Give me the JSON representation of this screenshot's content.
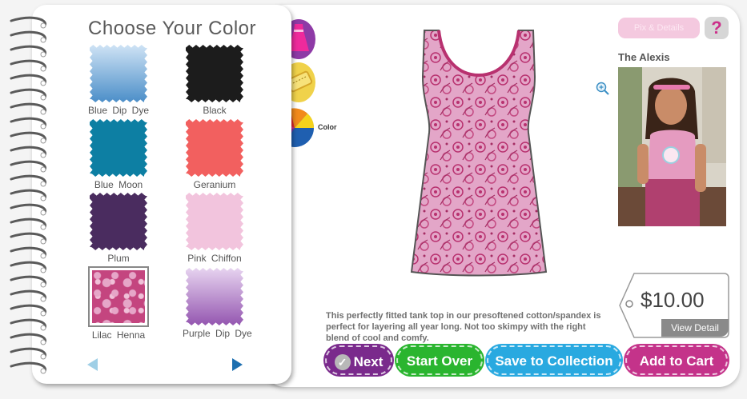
{
  "left_panel": {
    "title": "Choose Your Color",
    "swatches": [
      {
        "label": "Blue  Dip  Dye",
        "color_top": "#cfe3f5",
        "color_bottom": "#4b8ec8"
      },
      {
        "label": "Black",
        "color": "#1c1c1c"
      },
      {
        "label": "Blue  Moon",
        "color": "#0d7fa3"
      },
      {
        "label": "Geranium",
        "color": "#f2605f"
      },
      {
        "label": "Plum",
        "color": "#4a2c5f"
      },
      {
        "label": "Pink  Chiffon",
        "color": "#f2c4dd"
      },
      {
        "label": "Lilac  Henna",
        "color": "#c4457f",
        "selected": true
      },
      {
        "label": "Purple  Dip  Dye",
        "color_top": "#e7d4f0",
        "color_bottom": "#9456b0"
      }
    ],
    "prev_icon": "left-arrow",
    "next_icon": "right-arrow"
  },
  "side_tabs": {
    "style_icon": "dress-icon",
    "size_icon": "tape-measure-icon",
    "color_label": "Color"
  },
  "header": {
    "pix_details": "Pix & Details",
    "help": "?"
  },
  "model": {
    "title": "The Alexis"
  },
  "price": {
    "amount": "$10.00",
    "view_detail": "View  Detail"
  },
  "description": "This perfectly fitted tank top in our presoftened cotton/spandex is perfect for layering all year long. Not too skimpy with the right blend of cool and comfy.",
  "buttons": {
    "next": "Next",
    "start_over": "Start Over",
    "save_to_collection": "Save to Collection",
    "add_to_cart": "Add to Cart"
  },
  "colors": {
    "next_bg": "#7a2a8c",
    "start_over_bg": "#2ab52f",
    "save_bg": "#29a9e0",
    "add_cart_bg": "#c4338a",
    "accent_pink": "#cc2f8a"
  }
}
